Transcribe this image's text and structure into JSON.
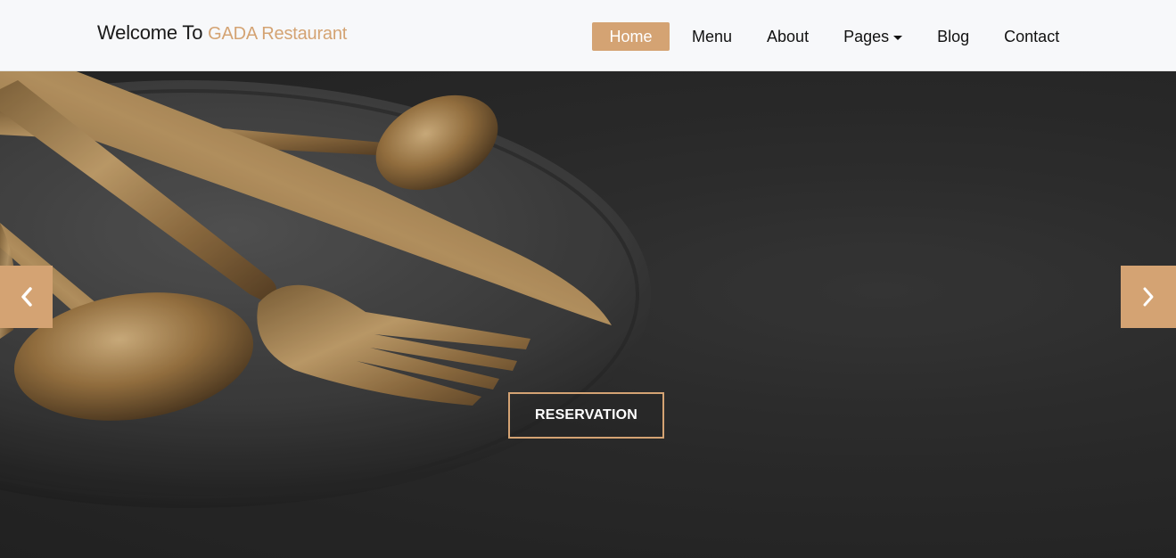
{
  "brand": {
    "prefix": "Welcome To",
    "name": "GADA Restaurant"
  },
  "nav": {
    "items": [
      {
        "label": "Home",
        "active": true
      },
      {
        "label": "Menu",
        "active": false
      },
      {
        "label": "About",
        "active": false
      },
      {
        "label": "Pages",
        "active": false,
        "dropdown": true
      },
      {
        "label": "Blog",
        "active": false
      },
      {
        "label": "Contact",
        "active": false
      }
    ]
  },
  "hero": {
    "cta_label": "RESERVATION",
    "prev_icon": "chevron-left-icon",
    "next_icon": "chevron-right-icon"
  },
  "colors": {
    "accent": "#d4a373",
    "navbar_bg": "#f7f8fa",
    "hero_bg": "#2f2f2f",
    "gold": "#b08a55"
  }
}
